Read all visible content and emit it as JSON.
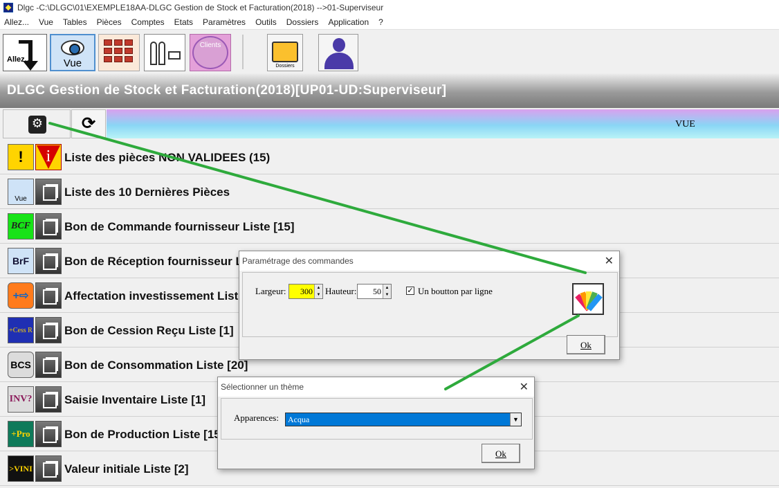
{
  "window": {
    "title": "Dlgc -C:\\DLGC\\01\\EXEMPLE18AA-DLGC Gestion de Stock et Facturation(2018) -->01-Superviseur"
  },
  "menubar": {
    "items": [
      "Allez...",
      "Vue",
      "Tables",
      "Pièces",
      "Comptes",
      "Etats",
      "Paramètres",
      "Outils",
      "Dossiers",
      "Application",
      "?"
    ]
  },
  "toolbar": {
    "allez_label": "Allez...",
    "vue_label": "Vue",
    "clients_label": "Clients",
    "dossiers_label": "Dossiers"
  },
  "banner": {
    "title": "DLGC Gestion de Stock et Facturation(2018)[UP01-UD:Superviseur]"
  },
  "strip": {
    "vue_label": "VUE"
  },
  "list": {
    "items": [
      {
        "label": "Liste des pièces NON VALIDEES (15)",
        "icon": "warning-icon",
        "icon_text": "!"
      },
      {
        "label": "Liste des 10 Dernières Pièces",
        "icon": "eye-icon",
        "icon_text": "Vue"
      },
      {
        "label": "Bon de Commande fournisseur Liste [15]",
        "icon": "bcf-icon",
        "icon_text": "BCF"
      },
      {
        "label": "Bon de Réception fournisseur Liste [",
        "icon": "brf-icon",
        "icon_text": "BrF"
      },
      {
        "label": "Affectation investissement Liste [",
        "icon": "affectation-icon",
        "icon_text": "+⇨"
      },
      {
        "label": "Bon de Cession Reçu Liste [1]",
        "icon": "cession-icon",
        "icon_text": "+Cess R"
      },
      {
        "label": "Bon de Consommation Liste [20]",
        "icon": "bcs-icon",
        "icon_text": "BCS"
      },
      {
        "label": "Saisie Inventaire Liste [1]",
        "icon": "inventaire-icon",
        "icon_text": "INV?"
      },
      {
        "label": "Bon de Production Liste [15]",
        "icon": "production-icon",
        "icon_text": "+Pro"
      },
      {
        "label": "Valeur initiale Liste [2]",
        "icon": "vini-icon",
        "icon_text": ">VINI"
      }
    ]
  },
  "dialog_commandes": {
    "title": "Paramétrage des commandes",
    "close": "✕",
    "largeur_label": "Largeur:",
    "largeur_value": "300",
    "hauteur_label": "Hauteur:",
    "hauteur_value": "50",
    "checkbox_label": "Un boutton par ligne",
    "checkbox_checked": "✓",
    "ok_label": "Ok"
  },
  "dialog_theme": {
    "title": "Sélectionner un thème",
    "close": "✕",
    "apparences_label": "Apparences:",
    "apparences_value": "Acqua",
    "ok_label": "Ok"
  },
  "colors": {
    "annotation_arrow": "#2eaa3c",
    "largeur_highlight": "#ffff00",
    "combo_selected": "#0078d7"
  }
}
